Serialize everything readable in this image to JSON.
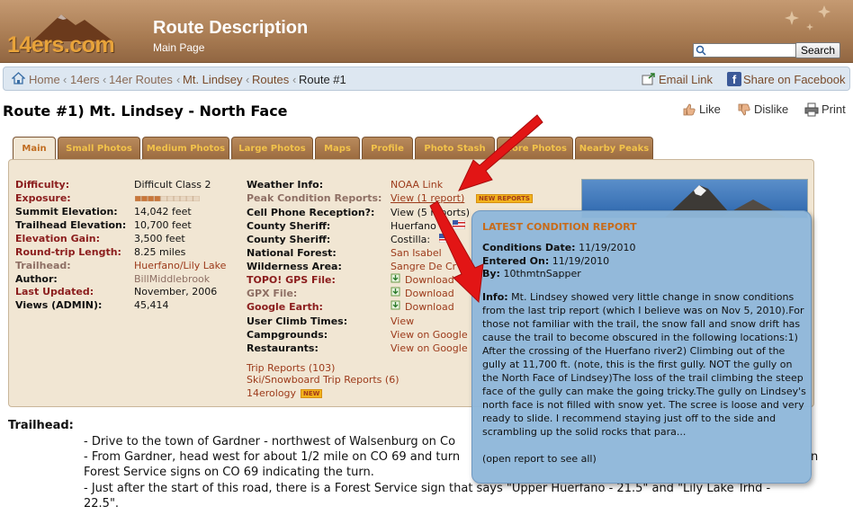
{
  "header": {
    "logo_text": "14ers.com",
    "title": "Route Description",
    "subtitle": "Main Page",
    "search_placeholder": "",
    "search_button": "Search"
  },
  "breadcrumb": {
    "items": [
      "Home",
      "14ers",
      "14er Routes",
      "Mt. Lindsey",
      "Routes",
      "Route #1"
    ],
    "separator": "‹",
    "email_link": "Email Link",
    "facebook": "Share on Facebook"
  },
  "page": {
    "title": "Route #1) Mt. Lindsey - North Face",
    "like": "Like",
    "dislike": "Dislike",
    "print": "Print"
  },
  "tabs": [
    "Main",
    "Small Photos",
    "Medium Photos",
    "Large Photos",
    "Maps",
    "Profile",
    "Photo Stash",
    "More Photos",
    "Nearby Peaks"
  ],
  "stats_left": [
    {
      "label": "Difficulty:",
      "value": "Difficult Class 2",
      "label_style": "red",
      "value_style": "plain"
    },
    {
      "label": "Exposure:",
      "value": "",
      "label_style": "red",
      "value_style": "bar"
    },
    {
      "label": "Summit Elevation:",
      "value": "14,042 feet",
      "label_style": "blk",
      "value_style": "plain"
    },
    {
      "label": "Trailhead Elevation:",
      "value": "10,700 feet",
      "label_style": "blk",
      "value_style": "plain"
    },
    {
      "label": "Elevation Gain:",
      "value": "3,500 feet",
      "label_style": "red",
      "value_style": "plain"
    },
    {
      "label": "Round-trip Length:",
      "value": "8.25 miles",
      "label_style": "red",
      "value_style": "plain"
    },
    {
      "label": "Trailhead:",
      "value": "Huerfano/Lily Lake",
      "label_style": "gry",
      "value_style": "link"
    },
    {
      "label": "Author:",
      "value": "BillMiddlebrook",
      "label_style": "blk",
      "value_style": "gry"
    },
    {
      "label": "Last Updated:",
      "value": "November, 2006",
      "label_style": "red",
      "value_style": "plain"
    },
    {
      "label": "Views (ADMIN):",
      "value": "45,414",
      "label_style": "blk",
      "value_style": "plain"
    }
  ],
  "exposure_level": 0.4,
  "stats_right": [
    {
      "label": "Weather Info:",
      "value": "NOAA Link",
      "label_style": "blk",
      "value_style": "link"
    },
    {
      "label": "Peak Condition Reports:",
      "value": "View (1 report)",
      "label_style": "gry",
      "value_style": "link",
      "badge": "NEW REPORTS"
    },
    {
      "label": "Cell Phone Reception?:",
      "value": "View (5 reports)",
      "label_style": "blk",
      "value_style": "plain"
    },
    {
      "label": "County Sheriff:",
      "value": "Huerfano",
      "label_style": "blk",
      "value_style": "plain"
    },
    {
      "label": "County Sheriff:",
      "value": "Costilla:",
      "label_style": "blk",
      "value_style": "plain"
    },
    {
      "label": "National Forest:",
      "value": "San Isabel",
      "label_style": "blk",
      "value_style": "link"
    },
    {
      "label": "Wilderness Area:",
      "value": "Sangre De Cr",
      "label_style": "blk",
      "value_style": "link"
    },
    {
      "label": "TOPO! GPS File:",
      "value": "Download",
      "label_style": "red",
      "value_style": "link"
    },
    {
      "label": "GPX File:",
      "value": "Download",
      "label_style": "gry",
      "value_style": "link"
    },
    {
      "label": "Google Earth:",
      "value": "Download",
      "label_style": "red",
      "value_style": "link"
    },
    {
      "label": "User Climb Times:",
      "value": "View",
      "label_style": "blk",
      "value_style": "link"
    },
    {
      "label": "Campgrounds:",
      "value": "View on Google",
      "label_style": "blk",
      "value_style": "link"
    },
    {
      "label": "Restaurants:",
      "value": "View on Google",
      "label_style": "blk",
      "value_style": "link"
    }
  ],
  "extra_links": [
    "Trip Reports (103)",
    "Ski/Snowboard Trip Reports (6)",
    "14erology"
  ],
  "extra_badge": "NEW",
  "trailhead": {
    "heading": "Trailhead:",
    "lines": [
      "- Drive to the town of Gardner - northwest of Walsenburg on Co",
      "- From Gardner, head west for about 1/2 mile on CO 69 and turn",
      "Forest Service signs on CO 69 indicating the turn.",
      "- Just after the start of this road, there is a Forest Service sign that says \"Upper Huerfano - 21.5\" and \"Lily Lake Trhd -",
      "22.5\"."
    ],
    "line_tail": "n"
  },
  "popup": {
    "title": "LATEST CONDITION REPORT",
    "conditions_label": "Conditions Date:",
    "conditions_value": "11/19/2010",
    "entered_label": "Entered On:",
    "entered_value": "11/19/2010",
    "by_label": "By:",
    "by_value": "10thmtnSapper",
    "info_label": "Info:",
    "info_text": "Mt. Lindsey showed very little change in snow conditions from the last trip report (which I believe was on Nov 5, 2010).For those not familiar with the trail, the snow fall and snow drift has cause the trail to become obscured in the following locations:1) After the crossing of the Huerfano river2) Climbing out of the gully at 11,700 ft. (note, this is the first gully. NOT the gully on the North Face of Lindsey)The loss of the trail climbing the steep face of the gully can make the going tricky.The gully on Lindsey's north face is not filled with snow yet. The scree is loose and very ready to slide. I recommend staying just off to the side and scrambling up the solid rocks that para...",
    "open_text": "(open report to see all)"
  },
  "colors": {
    "header_brown": "#a87b52",
    "tab_gold": "#f2c24a",
    "panel_tan": "#f1e6d3",
    "label_red": "#8b1d1d",
    "link_brown": "#9c3a1a",
    "popup_blue": "#8fb7da",
    "arrow_red": "#e21515"
  }
}
